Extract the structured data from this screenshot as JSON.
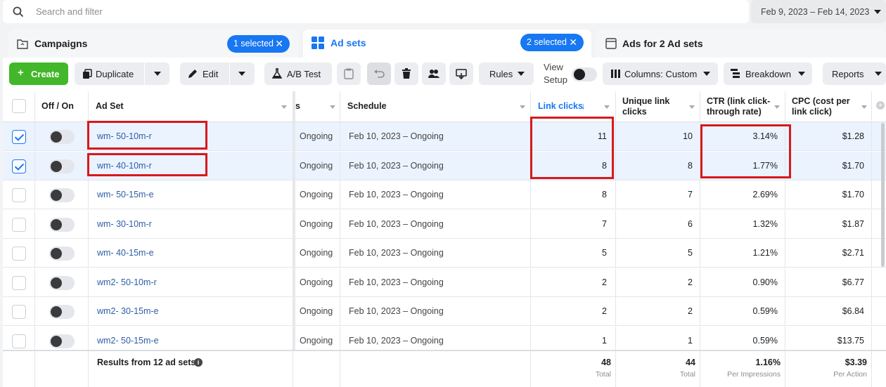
{
  "search": {
    "placeholder": "Search and filter",
    "icon": "search-icon"
  },
  "date_range": "Feb 9, 2023 – Feb 14, 2023",
  "tabs": [
    {
      "label": "Campaigns",
      "icon": "folder-icon"
    },
    {
      "label": "Ad sets",
      "icon": "grid-icon",
      "pill": "2 selected"
    },
    {
      "label": "Ads for 2 Ad sets",
      "icon": "ad-icon"
    }
  ],
  "campaigns_pill": "1 selected",
  "toolbar": {
    "create": "Create",
    "duplicate": "Duplicate",
    "edit": "Edit",
    "ab_test": "A/B Test",
    "rules": "Rules",
    "view_setup_1": "View",
    "view_setup_2": "Setup",
    "columns": "Columns: Custom",
    "breakdown": "Breakdown",
    "reports": "Reports"
  },
  "headers": {
    "offon": "Off / On",
    "adset": "Ad Set",
    "delivery": "s",
    "schedule": "Schedule",
    "link_clicks": "Link clicks",
    "unique_1": "Unique link",
    "unique_2": "clicks",
    "ctr_1": "CTR (link click-",
    "ctr_2": "through rate)",
    "cpc_1": "CPC (cost per",
    "cpc_2": "link click)"
  },
  "rows": [
    {
      "name": "wm- 50-10m-r",
      "delivery": "Ongoing",
      "schedule": "Feb 10, 2023 – Ongoing",
      "link_clicks": "11",
      "unique": "10",
      "ctr": "3.14%",
      "cpc": "$1.28"
    },
    {
      "name": "wm- 40-10m-r",
      "delivery": "Ongoing",
      "schedule": "Feb 10, 2023 – Ongoing",
      "link_clicks": "8",
      "unique": "8",
      "ctr": "1.77%",
      "cpc": "$1.70"
    },
    {
      "name": "wm- 50-15m-e",
      "delivery": "Ongoing",
      "schedule": "Feb 10, 2023 – Ongoing",
      "link_clicks": "8",
      "unique": "7",
      "ctr": "2.69%",
      "cpc": "$1.70"
    },
    {
      "name": "wm- 30-10m-r",
      "delivery": "Ongoing",
      "schedule": "Feb 10, 2023 – Ongoing",
      "link_clicks": "7",
      "unique": "6",
      "ctr": "1.32%",
      "cpc": "$1.87"
    },
    {
      "name": "wm- 40-15m-e",
      "delivery": "Ongoing",
      "schedule": "Feb 10, 2023 – Ongoing",
      "link_clicks": "5",
      "unique": "5",
      "ctr": "1.21%",
      "cpc": "$2.71"
    },
    {
      "name": "wm2- 50-10m-r",
      "delivery": "Ongoing",
      "schedule": "Feb 10, 2023 – Ongoing",
      "link_clicks": "2",
      "unique": "2",
      "ctr": "0.90%",
      "cpc": "$6.77"
    },
    {
      "name": "wm2- 30-15m-e",
      "delivery": "Ongoing",
      "schedule": "Feb 10, 2023 – Ongoing",
      "link_clicks": "2",
      "unique": "2",
      "ctr": "0.59%",
      "cpc": "$6.84"
    },
    {
      "name": "wm2- 50-15m-e",
      "delivery": "Ongoing",
      "schedule": "Feb 10, 2023 – Ongoing",
      "link_clicks": "1",
      "unique": "1",
      "ctr": "0.59%",
      "cpc": "$13.75"
    }
  ],
  "footer": {
    "label": "Results from 12 ad sets",
    "link_clicks": "48",
    "link_clicks_sub": "Total",
    "unique": "44",
    "unique_sub": "Total",
    "ctr": "1.16%",
    "ctr_sub": "Per Impressions",
    "cpc": "$3.39",
    "cpc_sub": "Per Action"
  },
  "colors": {
    "accent": "#1877f2",
    "create": "#42b72a",
    "highlight": "#d7191c",
    "link": "#2d5ea7"
  }
}
